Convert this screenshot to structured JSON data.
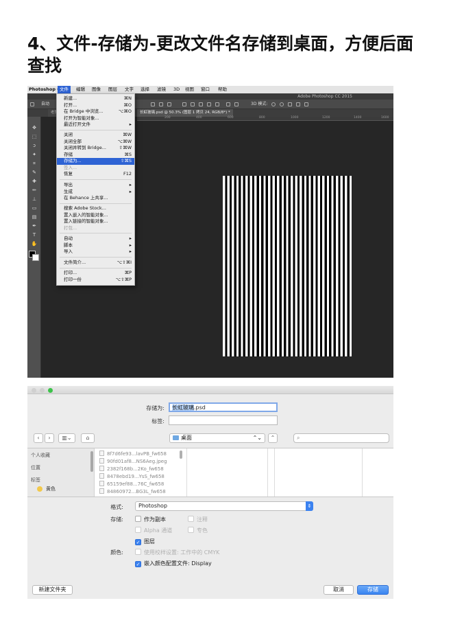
{
  "heading": "4、文件-存储为-更改文件名存储到桌面，方便后面查找",
  "photoshop": {
    "app_name": "Photoshop CC",
    "window_title": "Adobe Photoshop CC 2015",
    "menubar": [
      "文件",
      "编辑",
      "图像",
      "图层",
      "文字",
      "选择",
      "滤镜",
      "3D",
      "视图",
      "窗口",
      "帮助"
    ],
    "active_menu": "文件",
    "options": {
      "auto_select": "自动",
      "mode_3d": "3D 模式:"
    },
    "doc_tab_other": "老狗",
    "doc_tab": "长虹玻璃.psd @ 50.3% (图层 1 拷贝 24, RGB/8*) *",
    "ruler_ticks": [
      "200",
      "400",
      "600",
      "800",
      "1000",
      "1200",
      "1400",
      "1600"
    ],
    "file_menu": [
      {
        "label": "新建...",
        "shortcut": "⌘N"
      },
      {
        "label": "打开...",
        "shortcut": "⌘O"
      },
      {
        "label": "在 Bridge 中浏览...",
        "shortcut": "⌥⌘O"
      },
      {
        "label": "打开为智能对象...",
        "shortcut": ""
      },
      {
        "label": "最近打开文件",
        "shortcut": "▸"
      },
      {
        "label": "关闭",
        "shortcut": "⌘W"
      },
      {
        "label": "关闭全部",
        "shortcut": "⌥⌘W"
      },
      {
        "label": "关闭并转到 Bridge...",
        "shortcut": "⇧⌘W"
      },
      {
        "label": "存储",
        "shortcut": "⌘S"
      },
      {
        "label": "存储为...",
        "shortcut": "⇧⌘S"
      },
      {
        "label": "签入...",
        "shortcut": ""
      },
      {
        "label": "恢复",
        "shortcut": "F12"
      },
      {
        "label": "导出",
        "shortcut": "▸"
      },
      {
        "label": "生成",
        "shortcut": "▸"
      },
      {
        "label": "在 Behance 上共享...",
        "shortcut": ""
      },
      {
        "label": "搜索 Adobe Stock...",
        "shortcut": ""
      },
      {
        "label": "置入嵌入的智能对象...",
        "shortcut": ""
      },
      {
        "label": "置入链接的智能对象...",
        "shortcut": ""
      },
      {
        "label": "打包...",
        "shortcut": ""
      },
      {
        "label": "自动",
        "shortcut": "▸"
      },
      {
        "label": "脚本",
        "shortcut": "▸"
      },
      {
        "label": "导入",
        "shortcut": "▸"
      },
      {
        "label": "文件简介...",
        "shortcut": "⌥⇧⌘I"
      },
      {
        "label": "打印...",
        "shortcut": "⌘P"
      },
      {
        "label": "打印一份",
        "shortcut": "⌥⇧⌘P"
      }
    ],
    "highlighted_item": "存储为..."
  },
  "save_dialog": {
    "save_as_label": "存储为:",
    "filename_selected": "长虹玻璃",
    "filename_ext": ".psd",
    "tags_label": "标签:",
    "location": "桌面",
    "sidebar": {
      "favorites": "个人收藏",
      "locations": "位置",
      "tags": "标签",
      "tag_yellow": "黄色"
    },
    "files": [
      "8f7d6fe93...lavPB_fw658",
      "90fd01af8...NS6Aeg.jpeg",
      "2382f168b...2Ko_fw658",
      "8478ebd19...YsS_fw658",
      "65159ef88...76C_fw658",
      "84860972...BG3L_fw658"
    ],
    "format_label": "格式:",
    "format_value": "Photoshop",
    "save_label": "存储:",
    "as_copy": "作为副本",
    "notes": "注释",
    "alpha": "Alpha 通道",
    "spot": "专色",
    "layers": "图层",
    "color_label": "颜色:",
    "proof": "使用校样设置: 工作中的 CMYK",
    "embed_profile": "嵌入颜色配置文件: Display",
    "new_folder": "新建文件夹",
    "cancel": "取消",
    "save": "存储"
  }
}
